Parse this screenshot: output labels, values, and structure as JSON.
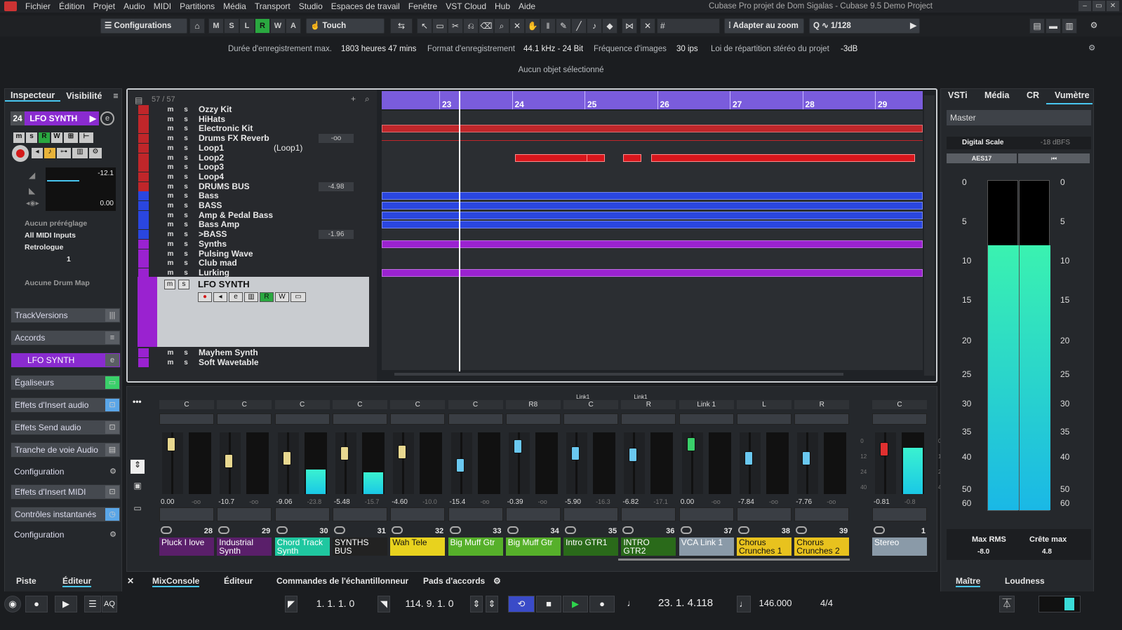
{
  "menu": {
    "items": [
      "Fichier",
      "Édition",
      "Projet",
      "Audio",
      "MIDI",
      "Partitions",
      "Média",
      "Transport",
      "Studio",
      "Espaces de travail",
      "Fenêtre",
      "VST Cloud",
      "Hub",
      "Aide"
    ],
    "title": "Cubase Pro projet de Dom Sigalas - Cubase 9.5 Demo Project"
  },
  "toolbar": {
    "config": "Configurations",
    "modes": [
      "M",
      "S",
      "L",
      "R",
      "W",
      "A"
    ],
    "touch": "Touch",
    "zoom": "Adapter au zoom",
    "quant": "1/128"
  },
  "info": {
    "rec_max_label": "Durée d'enregistrement max.",
    "rec_max": "1803 heures 47 mins",
    "fmt_label": "Format d'enregistrement",
    "fmt": "44.1 kHz - 24 Bit",
    "fps_label": "Fréquence d'images",
    "fps": "30 ips",
    "pan_label": "Loi de répartition stéréo du projet",
    "pan": "-3dB"
  },
  "status": "Aucun objet sélectionné",
  "inspector": {
    "tab1": "Inspecteur",
    "tab2": "Visibilité",
    "track_num": "24",
    "track_name": "LFO SYNTH",
    "vol": "-12.1",
    "pan": "0.00",
    "preset": "Aucun préréglage",
    "input": "All MIDI Inputs",
    "output": "Retrologue",
    "channel": "1",
    "drum": "Aucune Drum Map",
    "sections": [
      "TrackVersions",
      "Accords",
      "LFO SYNTH",
      "Égaliseurs",
      "Effets d'Insert audio",
      "Effets Send audio",
      "Tranche de voie Audio",
      "Configuration",
      "Effets d'Insert MIDI",
      "Contrôles instantanés",
      "Configuration"
    ]
  },
  "project": {
    "count": "57 / 57",
    "ruler": [
      "23",
      "24",
      "25",
      "26",
      "27",
      "28",
      "29"
    ],
    "tracks": [
      {
        "n": "Ozzy Kit",
        "c": "#c0262a",
        "v": ""
      },
      {
        "n": "HiHats",
        "c": "#c0262a",
        "v": ""
      },
      {
        "n": "Electronic Kit",
        "c": "#c0262a",
        "v": ""
      },
      {
        "n": "Drums FX Reverb",
        "c": "#c0262a",
        "v": "-oo"
      },
      {
        "n": "Loop1",
        "c": "#c0262a",
        "v": "",
        "x": "(Loop1)"
      },
      {
        "n": "Loop2",
        "c": "#c0262a",
        "v": ""
      },
      {
        "n": "Loop3",
        "c": "#c0262a",
        "v": ""
      },
      {
        "n": "Loop4",
        "c": "#c0262a",
        "v": ""
      },
      {
        "n": "DRUMS BUS",
        "c": "#c0262a",
        "v": "-4.98"
      },
      {
        "n": "Bass",
        "c": "#2a46e0",
        "v": ""
      },
      {
        "n": "BASS",
        "c": "#2a46e0",
        "v": ""
      },
      {
        "n": "Amp & Pedal Bass",
        "c": "#2a46e0",
        "v": ""
      },
      {
        "n": "Bass Amp",
        "c": "#2a46e0",
        "v": ""
      },
      {
        "n": ">BASS",
        "c": "#2a46e0",
        "v": "-1.96"
      },
      {
        "n": "Synths",
        "c": "#9a22d0",
        "v": ""
      },
      {
        "n": "Pulsing Wave",
        "c": "#9a22d0",
        "v": ""
      },
      {
        "n": "Club mad",
        "c": "#9a22d0",
        "v": ""
      },
      {
        "n": "Lurking",
        "c": "#9a22d0",
        "v": ""
      }
    ],
    "selected": "LFO SYNTH",
    "after": [
      "Mayhem Synth",
      "Soft Wavetable"
    ]
  },
  "mixer": {
    "channels": [
      {
        "pan": "C",
        "vol": "0.00",
        "pk": "-oo",
        "num": "28",
        "name": "Pluck I love",
        "bg": "#5a1f6a",
        "fg": "#fff",
        "k": 0.1,
        "m": 0
      },
      {
        "pan": "C",
        "vol": "-10.7",
        "pk": "-oo",
        "num": "29",
        "name": "Industrial Synth",
        "bg": "#5a1f6a",
        "fg": "#fff",
        "k": 0.45,
        "m": 0
      },
      {
        "pan": "C",
        "vol": "-9.06",
        "pk": "-23.8",
        "num": "30",
        "name": "Chord Track Synth",
        "bg": "#1fc7a0",
        "fg": "#fff",
        "k": 0.4,
        "m": 0.4
      },
      {
        "pan": "C",
        "vol": "-5.48",
        "pk": "-15.7",
        "num": "31",
        "name": "SYNTHS BUS",
        "bg": "#222",
        "fg": "#fff",
        "k": 0.3,
        "m": 0.35
      },
      {
        "pan": "C",
        "vol": "-4.60",
        "pk": "-10.0",
        "num": "32",
        "name": "Wah Tele",
        "bg": "#e8d21e",
        "fg": "#111",
        "k": 0.27,
        "m": 0
      },
      {
        "pan": "C",
        "vol": "-15.4",
        "pk": "-oo",
        "num": "33",
        "name": "Big Muff Gtr",
        "bg": "#56b02a",
        "fg": "#fff",
        "k": 0.55,
        "m": 0
      },
      {
        "pan": "R8",
        "vol": "-0.39",
        "pk": "-oo",
        "num": "34",
        "name": "Big Muff Gtr",
        "bg": "#56b02a",
        "fg": "#fff",
        "k": 0.15,
        "m": 0
      },
      {
        "pan": "C",
        "vol": "-5.90",
        "pk": "-16.3",
        "num": "35",
        "name": "Intro GTR1",
        "bg": "#2a6a1a",
        "fg": "#fff",
        "k": 0.3,
        "m": 0,
        "link": "Link1"
      },
      {
        "pan": "R",
        "vol": "-6.82",
        "pk": "-17.1",
        "num": "36",
        "name": "INTRO GTR2",
        "bg": "#2a6a1a",
        "fg": "#fff",
        "k": 0.33,
        "m": 0,
        "link": "Link1"
      },
      {
        "pan": "Link 1",
        "vol": "0.00",
        "pk": "-oo",
        "num": "37",
        "name": "VCA Link 1",
        "bg": "#8a9aa8",
        "fg": "#fff",
        "k": 0.1,
        "m": 0
      },
      {
        "pan": "L",
        "vol": "-7.84",
        "pk": "-oo",
        "num": "38",
        "name": "Chorus Crunches 1",
        "bg": "#e8c21e",
        "fg": "#111",
        "k": 0.4,
        "m": 0
      },
      {
        "pan": "R",
        "vol": "-7.76",
        "pk": "-oo",
        "num": "39",
        "name": "Chorus Crunches 2",
        "bg": "#e8c21e",
        "fg": "#111",
        "k": 0.4,
        "m": 0
      },
      {
        "pan": "C",
        "vol": "-0.81",
        "pk": "-0.8",
        "num": "1",
        "name": "Stereo",
        "bg": "#8a9aa8",
        "fg": "#fff",
        "k": 0.2,
        "m": 0.75
      }
    ],
    "scale": [
      "0",
      "12",
      "24",
      "40"
    ]
  },
  "right": {
    "tabs": [
      "VSTi",
      "Média",
      "CR",
      "Vumètre"
    ],
    "master": "Master",
    "scale_name": "Digital Scale",
    "scale_val": "-18 dBFS",
    "aes": "AES17",
    "meter_scale": [
      "0",
      "5",
      "10",
      "15",
      "20",
      "25",
      "30",
      "35",
      "40",
      "50",
      "60"
    ],
    "rms_label": "Max RMS",
    "rms": "-8.0",
    "peak_label": "Crête max",
    "peak": "4.8",
    "level_l": 0.8,
    "level_r": 0.8
  },
  "bottom_tabs": [
    "Piste",
    "Éditeur",
    "MixConsole",
    "Éditeur",
    "Commandes de l'échantillonneur",
    "Pads d'accords",
    "Maître",
    "Loudness"
  ],
  "transport": {
    "left": "1. 1. 1.  0",
    "right": "114. 9. 1.  0",
    "pos": "23.  1.  4.118",
    "tempo": "146.000",
    "sig": "4/4",
    "aq": "AQ"
  }
}
